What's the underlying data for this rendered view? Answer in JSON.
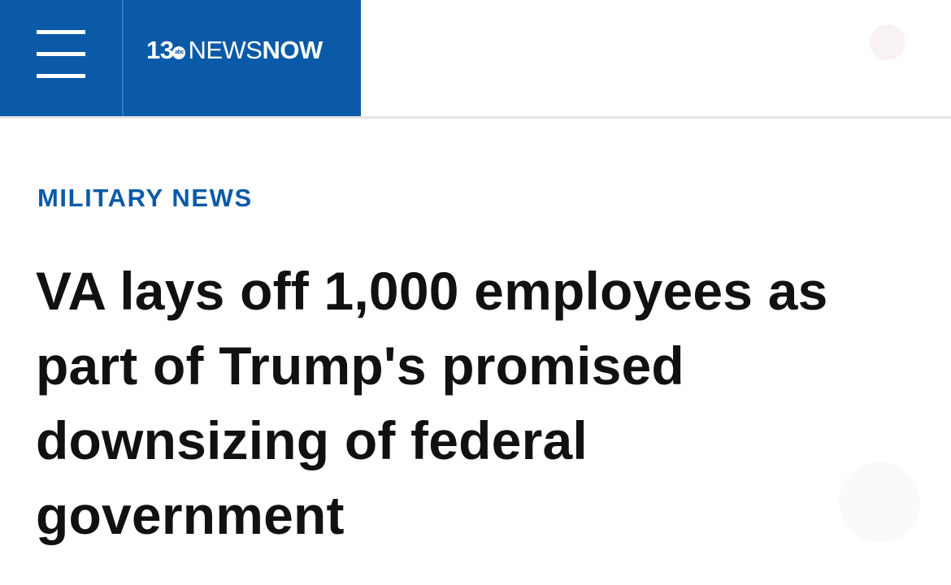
{
  "header": {
    "logo": {
      "number": "13",
      "network_badge": "abc",
      "news": "NEWS",
      "now": "NOW"
    },
    "brand_color": "#0a5aa8",
    "menu_icon": "hamburger-menu-icon",
    "weather": {
      "icon": "weather-sun-icon"
    }
  },
  "article": {
    "category": "MILITARY NEWS",
    "headline": "VA lays off 1,000 employees as part of Trump's promised downsizing of federal government"
  }
}
